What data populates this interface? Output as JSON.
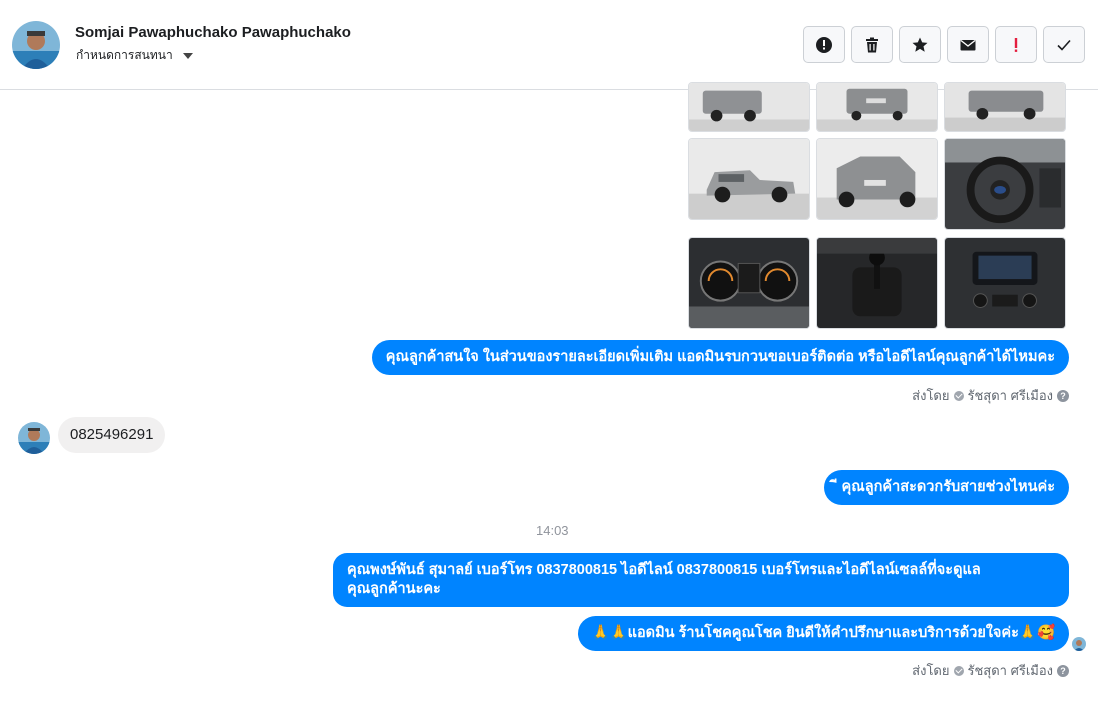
{
  "header": {
    "contact_name": "Somjai Pawaphuchako Pawaphuchako",
    "assign_label": "กำหนดการสนทนา",
    "toolbar": {
      "icons": [
        "info-circle-icon",
        "trash-icon",
        "star-icon",
        "envelope-icon",
        "exclamation-icon",
        "checkmark-icon"
      ],
      "alert_color": "#e41e3f"
    }
  },
  "messages": {
    "msg1": "คุณลูกค้าสนใจ ในส่วนของรายละเอียดเพิ่มเติม แอดมินรบกวนขอเบอร์ติดต่อ หรือไอดีไลน์คุณลูกค้าได้ไหมคะ",
    "sent_by_1": {
      "prefix": "ส่งโดย",
      "name": "รัชสุดา ศรีเมือง"
    },
    "incoming_phone": "0825496291",
    "msg2": "ี คุณลูกค้าสะดวกรับสายช่วงไหนค่ะ",
    "timestamp": "14:03",
    "msg3_line1": "คุณพงษ์พันธ์ สุมาลย์      เบอร์โทร 0837800815  ไอดีไลน์ 0837800815   เบอร์โทรและไอดีไลน์เซลล์ที่จะดูแล",
    "msg3_line2": "คุณลูกค้านะคะ",
    "msg4": "🙏🙏แอดมิน ร้านโชคคูณโชค ยินดีให้คำปรึกษาและบริการด้วยใจค่ะ🙏🥰",
    "sent_by_2": {
      "prefix": "ส่งโดย",
      "name": "รัชสุดา ศรีเมือง"
    }
  },
  "colors": {
    "messenger_blue": "#0084ff",
    "incoming_bg": "#f1f0f0"
  }
}
